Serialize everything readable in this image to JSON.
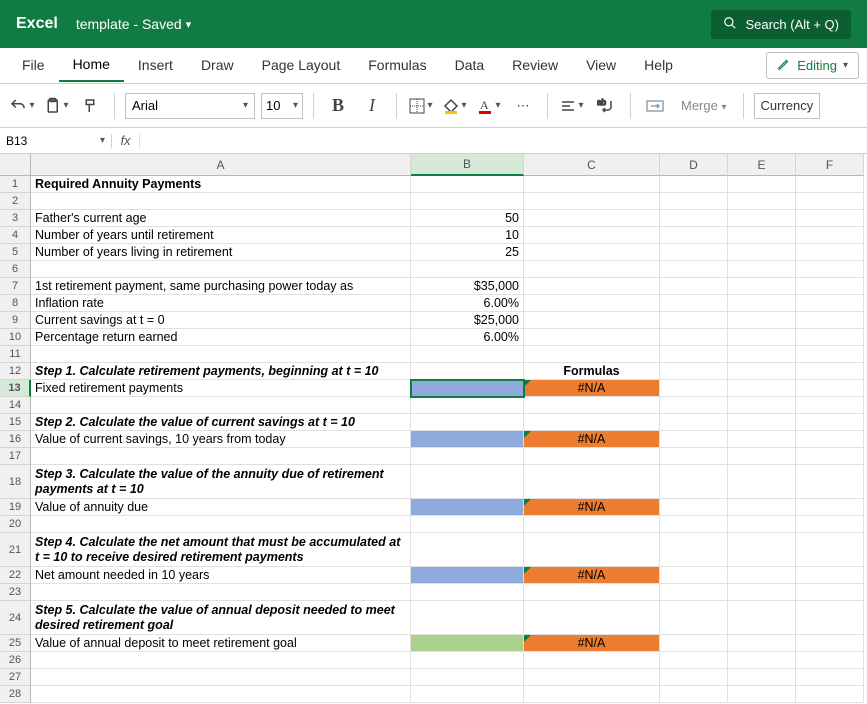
{
  "title_bar": {
    "app": "Excel",
    "doc": "template - Saved",
    "search": "Search (Alt + Q)"
  },
  "tabs": [
    "File",
    "Home",
    "Insert",
    "Draw",
    "Page Layout",
    "Formulas",
    "Data",
    "Review",
    "View",
    "Help"
  ],
  "active_tab": "Home",
  "editing_label": "Editing",
  "toolbar": {
    "font": "Arial",
    "size": "10",
    "merge": "Merge",
    "currency": "Currency"
  },
  "name_box": "B13",
  "columns": [
    "A",
    "B",
    "C",
    "D",
    "E",
    "F"
  ],
  "rows": {
    "1": {
      "A": "Required Annuity Payments"
    },
    "3": {
      "A": "Father's current age",
      "B": "50"
    },
    "4": {
      "A": "Number of years until retirement",
      "B": "10"
    },
    "5": {
      "A": "Number of years living in retirement",
      "B": "25"
    },
    "7": {
      "A": "1st retirement payment, same purchasing power today as",
      "B": "$35,000"
    },
    "8": {
      "A": "Inflation rate",
      "B": "6.00%"
    },
    "9": {
      "A": "Current savings at t = 0",
      "B": "$25,000"
    },
    "10": {
      "A": "Percentage return earned",
      "B": "6.00%"
    },
    "12": {
      "A": "Step 1. Calculate retirement payments, beginning at t = 10",
      "C": "Formulas"
    },
    "13": {
      "A": "Fixed retirement payments",
      "C": "#N/A"
    },
    "15": {
      "A": "Step 2. Calculate the value of current savings at t = 10"
    },
    "16": {
      "A": "Value of current savings, 10 years from today",
      "C": "#N/A"
    },
    "18": {
      "A": "Step 3. Calculate the value of the annuity due of retirement payments at t = 10"
    },
    "19": {
      "A": "Value of annuity due",
      "C": "#N/A"
    },
    "21": {
      "A": "Step 4. Calculate the net amount that must be accumulated at t = 10 to receive desired retirement payments"
    },
    "22": {
      "A": "Net amount needed in 10 years",
      "C": "#N/A"
    },
    "24": {
      "A": "Step 5. Calculate the value of annual deposit needed to meet desired retirement goal"
    },
    "25": {
      "A": "Value of annual deposit to meet retirement goal",
      "C": "#N/A"
    }
  }
}
